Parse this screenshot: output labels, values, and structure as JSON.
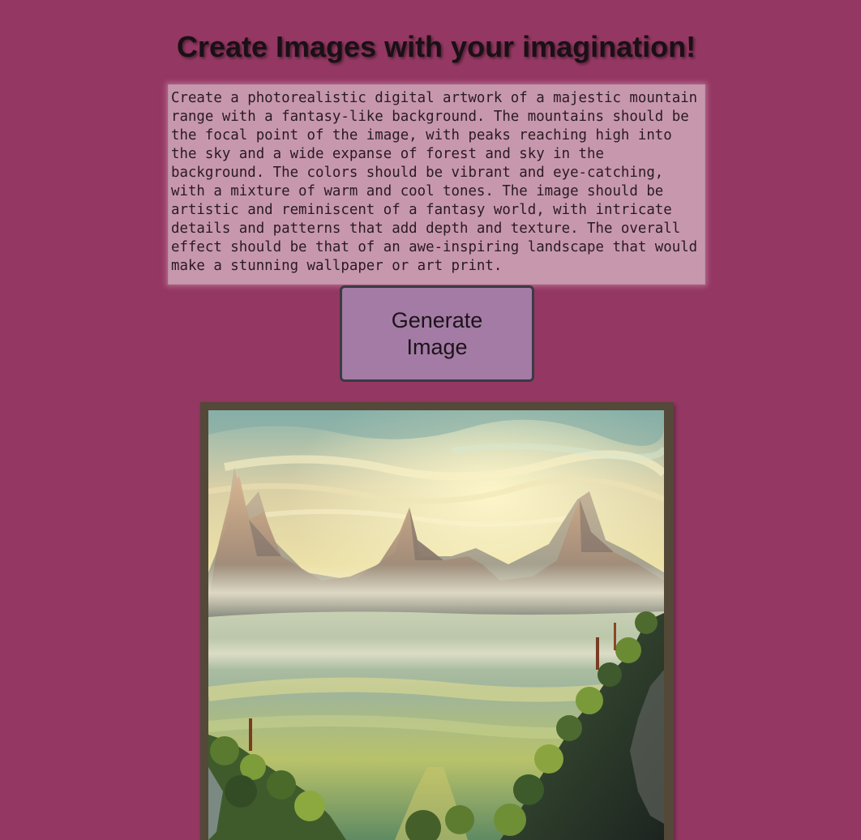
{
  "page": {
    "title": "Create Images with your imagination!"
  },
  "prompt": {
    "value": "Create a photorealistic digital artwork of a majestic mountain range with a fantasy-like background. The mountains should be the focal point of the image, with peaks reaching high into the sky and a wide expanse of forest and sky in the background. The colors should be vibrant and eye-catching, with a mixture of warm and cool tones. The image should be artistic and reminiscent of a fantasy world, with intricate details and patterns that add depth and texture. The overall effect should be that of an awe-inspiring landscape that would make a stunning wallpaper or art print."
  },
  "generate": {
    "label": "Generate Image"
  },
  "colors": {
    "background": "#943863",
    "textarea": "#c798ad",
    "button": "#a37ba5",
    "frame": "#544838"
  }
}
